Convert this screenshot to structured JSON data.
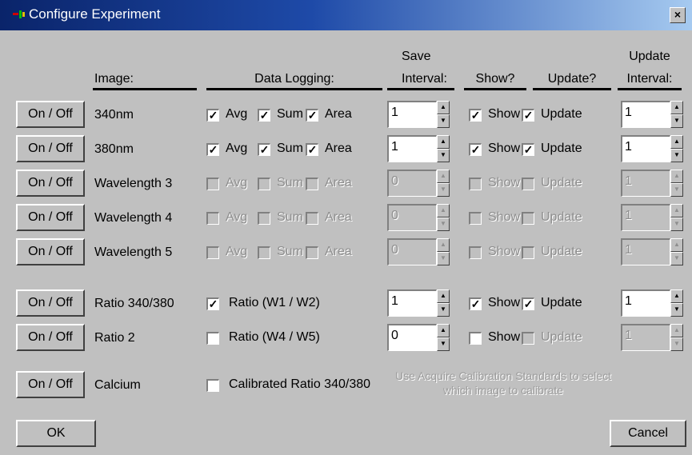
{
  "window": {
    "title": "Configure Experiment",
    "close_glyph": "×"
  },
  "headers": {
    "image": "Image:",
    "data_logging": "Data Logging:",
    "save_interval_1": "Save",
    "save_interval_2": "Interval:",
    "show": "Show?",
    "update": "Update?",
    "update_interval_1": "Update",
    "update_interval_2": "Interval:"
  },
  "on_off_label": "On / Off",
  "rows": [
    {
      "label": "340nm",
      "avg": "Avg",
      "sum": "Sum",
      "area": "Area",
      "save_interval": "1",
      "show": "Show",
      "update": "Update",
      "update_interval": "1"
    },
    {
      "label": "380nm",
      "avg": "Avg",
      "sum": "Sum",
      "area": "Area",
      "save_interval": "1",
      "show": "Show",
      "update": "Update",
      "update_interval": "1"
    },
    {
      "label": "Wavelength 3",
      "avg": "Avg",
      "sum": "Sum",
      "area": "Area",
      "save_interval": "0",
      "show": "Show",
      "update": "Update",
      "update_interval": "1"
    },
    {
      "label": "Wavelength 4",
      "avg": "Avg",
      "sum": "Sum",
      "area": "Area",
      "save_interval": "0",
      "show": "Show",
      "update": "Update",
      "update_interval": "1"
    },
    {
      "label": "Wavelength 5",
      "avg": "Avg",
      "sum": "Sum",
      "area": "Area",
      "save_interval": "0",
      "show": "Show",
      "update": "Update",
      "update_interval": "1"
    }
  ],
  "ratio_rows": [
    {
      "label": "Ratio 340/380",
      "ratio": "Ratio (W1 / W2)",
      "save_interval": "1",
      "show": "Show",
      "update": "Update",
      "update_interval": "1"
    },
    {
      "label": "Ratio 2",
      "ratio": "Ratio (W4 / W5)",
      "save_interval": "0",
      "show": "Show",
      "update": "Update",
      "update_interval": "1"
    }
  ],
  "calcium": {
    "label": "Calcium",
    "calibrated": "Calibrated Ratio 340/380",
    "note": "Use Acquire Calibration Standards to select which image to calibrate"
  },
  "buttons": {
    "ok": "OK",
    "cancel": "Cancel"
  },
  "checkmark": "✓"
}
